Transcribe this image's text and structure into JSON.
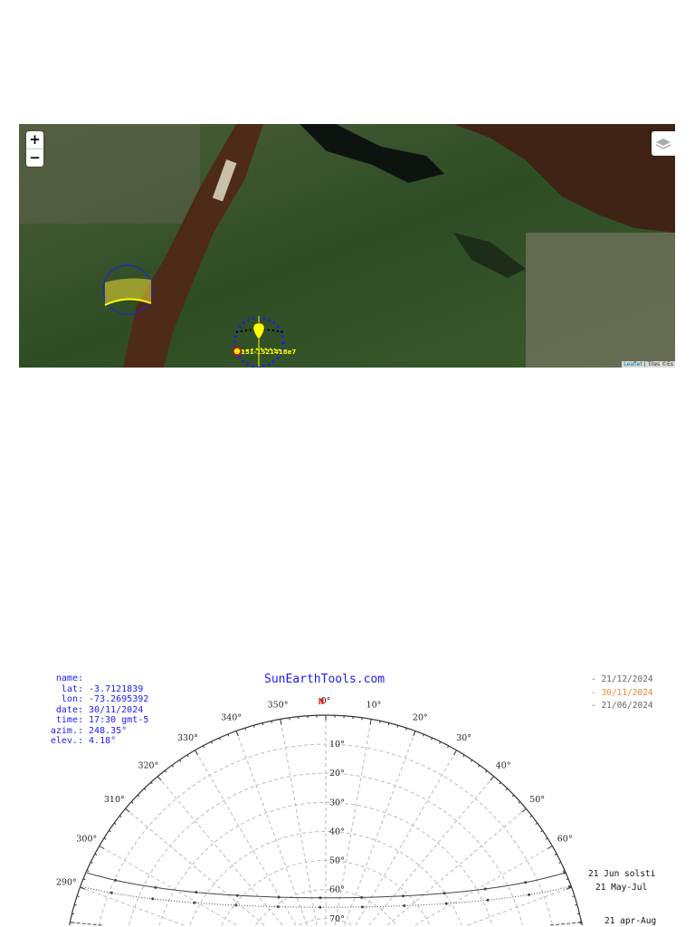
{
  "map": {
    "zoom_in_label": "+",
    "zoom_out_label": "−",
    "layers_icon": "layers-icon",
    "attribution_link": "Leaflet",
    "attribution_text": " | Tiles ©Es",
    "marker_label": "151-1521418e7"
  },
  "info": {
    "name_label": "name:",
    "name_value": "",
    "lat_label": "lat:",
    "lat_value": "-3.7121839",
    "lon_label": "lon:",
    "lon_value": "-73.2695392",
    "date_label": "date:",
    "date_value": "30/11/2024",
    "time_label": "time:",
    "time_value": "17:30 gmt-5",
    "azim_label": "azim.:",
    "azim_value": "248.35°",
    "elev_label": "elev.:",
    "elev_value": "4.18°"
  },
  "brand": "SunEarthTools.com",
  "legend": [
    {
      "label": "- 21/12/2024",
      "color": "#666666"
    },
    {
      "label": "- 30/11/2024",
      "color": "#e8883a"
    },
    {
      "label": "- 21/06/2024",
      "color": "#666666"
    }
  ],
  "chart_data": {
    "type": "line",
    "projection": "polar-sun-path",
    "north_label": "N",
    "north_color": "#ff0000",
    "latitude": -3.7121839,
    "azimuth_labels": [
      "350°",
      "0°",
      "10°",
      "20°",
      "30°",
      "40°",
      "50°",
      "60°",
      "290°",
      "300°",
      "310°",
      "320°",
      "330°",
      "340°"
    ],
    "azimuth_values": [
      350,
      0,
      10,
      20,
      30,
      40,
      50,
      60,
      290,
      300,
      310,
      320,
      330,
      340
    ],
    "elevation_labels": [
      "10°",
      "20°",
      "30°",
      "40°",
      "50°",
      "60°",
      "70°"
    ],
    "elevation_values": [
      10,
      20,
      30,
      40,
      50,
      60,
      70
    ],
    "series": [
      {
        "name": "21 Jun  solsti",
        "declination": 23.44,
        "style": "solid"
      },
      {
        "name": "21 May-Jul",
        "declination": 20.2,
        "style": "dotted"
      },
      {
        "name": "21 apr-Aug",
        "declination": 12.0,
        "style": "dashed"
      }
    ]
  }
}
